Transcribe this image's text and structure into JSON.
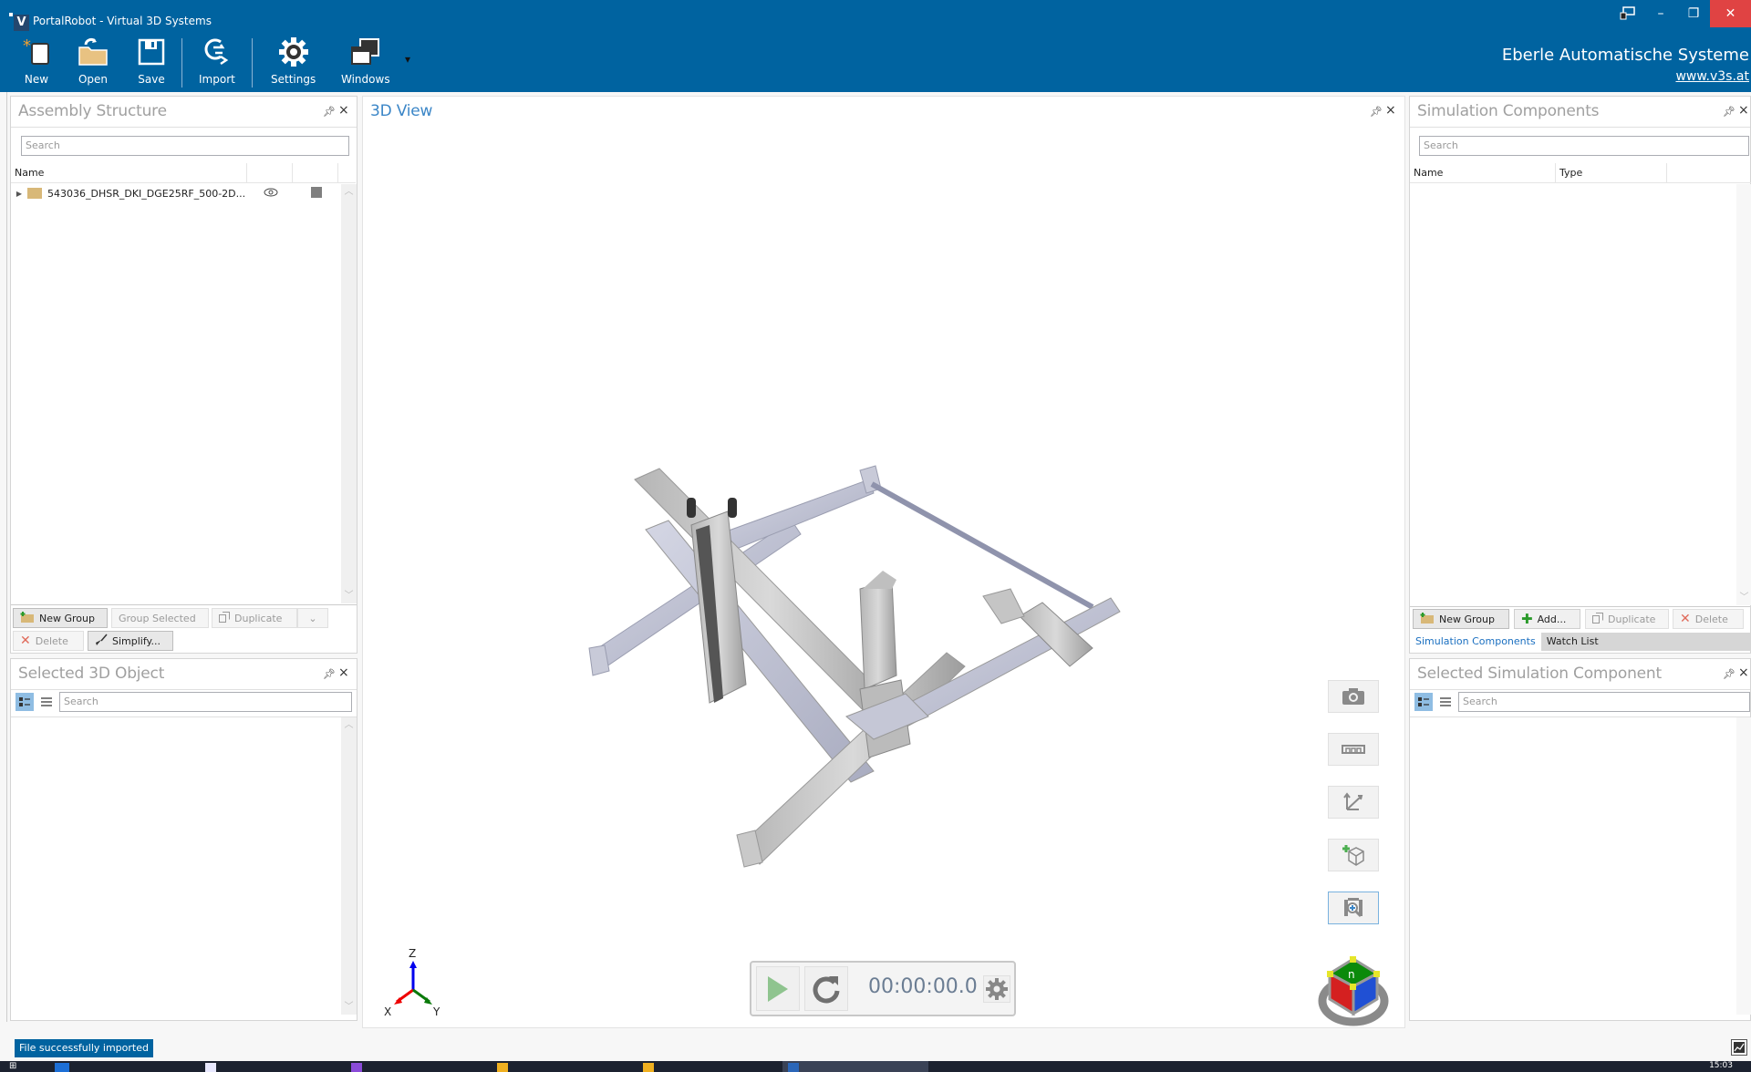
{
  "window": {
    "title": "PortalRobot - Virtual 3D Systems",
    "logo_letter": "V",
    "controls": {
      "minimize": "–",
      "restore": "❐",
      "close": "✕"
    }
  },
  "ribbon": {
    "buttons": [
      {
        "id": "new",
        "label": "New",
        "icon": "new-document-icon"
      },
      {
        "id": "open",
        "label": "Open",
        "icon": "open-folder-icon"
      },
      {
        "id": "save",
        "label": "Save",
        "icon": "floppy-save-icon"
      },
      {
        "id": "import",
        "label": "Import",
        "icon": "import-icon"
      },
      {
        "id": "settings",
        "label": "Settings",
        "icon": "gear-icon"
      },
      {
        "id": "windows",
        "label": "Windows",
        "icon": "windows-icon"
      }
    ],
    "overflow": "▾",
    "brand": "Eberle Automatische Systeme",
    "brand_link": "www.v3s.at"
  },
  "assembly_structure": {
    "title": "Assembly Structure",
    "search_placeholder": "Search",
    "columns": [
      "Name",
      "",
      ""
    ],
    "rows": [
      {
        "name": "543036_DHSR_DKI_DGE25RF_500-2D...",
        "visible": true,
        "color": "#7f7f7f"
      }
    ],
    "buttons": {
      "new_group": "New Group",
      "group_selected": "Group Selected",
      "duplicate": "Duplicate",
      "delete": "Delete",
      "simplify": "Simplify..."
    }
  },
  "selected_3d_object": {
    "title": "Selected 3D Object",
    "search_placeholder": "Search"
  },
  "view3d": {
    "title": "3D View",
    "axes": {
      "x": "X",
      "y": "Y",
      "z": "Z"
    },
    "tools": [
      "camera-icon",
      "ruler-icon",
      "axes-icon",
      "add-object-icon",
      "zoom-fit-icon"
    ],
    "simulation": {
      "time": "00:00:00.0"
    },
    "view_cube_label": "n"
  },
  "simulation_components": {
    "title": "Simulation Components",
    "search_placeholder": "Search",
    "columns": [
      "Name",
      "Type",
      ""
    ],
    "buttons": {
      "new_group": "New Group",
      "add": "Add...",
      "duplicate": "Duplicate",
      "delete": "Delete"
    },
    "tabs": [
      {
        "label": "Simulation Components",
        "active": true
      },
      {
        "label": "Watch List",
        "active": false
      }
    ]
  },
  "selected_simulation_component": {
    "title": "Selected Simulation Component",
    "search_placeholder": "Search"
  },
  "status": {
    "message": "File successfully imported",
    "clock": "15:03"
  },
  "colors": {
    "accent": "#0063a0",
    "close_red": "#e04343",
    "title_blue": "#3b86c7",
    "play_green": "#8fc48f"
  }
}
